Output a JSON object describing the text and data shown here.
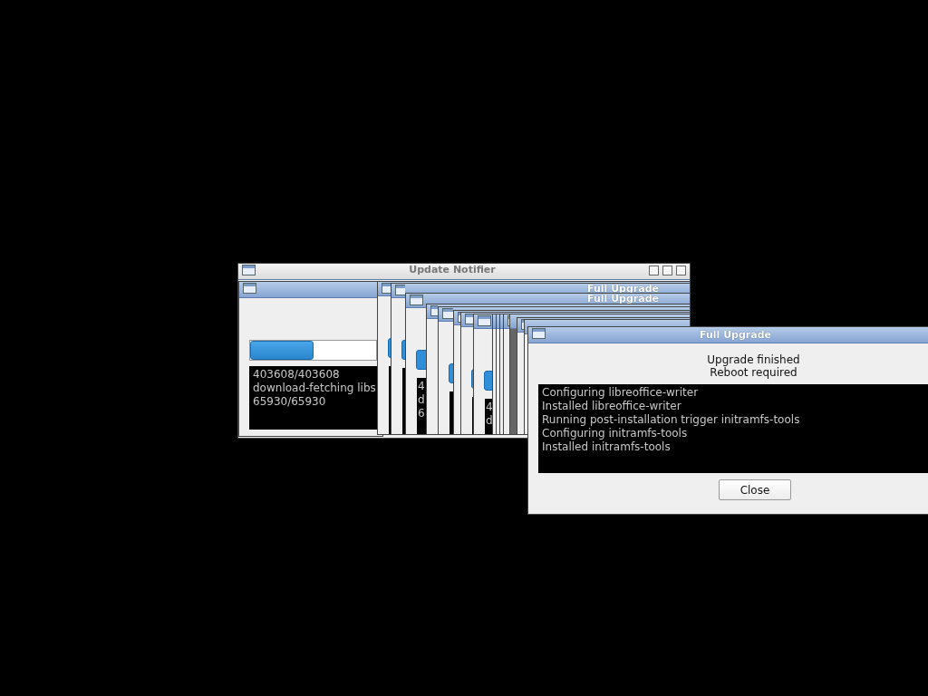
{
  "update_notifier": {
    "title": "Update Notifier"
  },
  "progress_window": {
    "level": 0.5,
    "log": [
      "403608/403608",
      "download-fetching libs",
      "65930/65930"
    ]
  },
  "stacked_windows": [
    {
      "kind": "progress"
    },
    {
      "kind": "progress",
      "title": "Full Upgrade"
    },
    {
      "kind": "progress",
      "title": "Full Upgrade",
      "log": [
        "4",
        "d",
        "6"
      ]
    },
    {
      "kind": "progress"
    },
    {
      "kind": "progress"
    },
    {
      "kind": "progress"
    },
    {
      "kind": "progress"
    },
    {
      "kind": "progress",
      "log": [
        "4",
        "d"
      ]
    },
    {
      "kind": "sliver"
    },
    {
      "kind": "sliver"
    },
    {
      "kind": "sliver"
    },
    {
      "kind": "sliver"
    },
    {
      "kind": "shaded"
    },
    {
      "kind": "sliver"
    },
    {
      "kind": "sliver"
    }
  ],
  "finished_window": {
    "title": "Full Upgrade",
    "message": [
      "Upgrade finished",
      "Reboot required"
    ],
    "log": [
      "Configuring libreoffice-writer",
      "Installed libreoffice-writer",
      "Running post-installation trigger initramfs-tools",
      "Configuring initramfs-tools",
      "Installed initramfs-tools"
    ],
    "button": "Close"
  }
}
